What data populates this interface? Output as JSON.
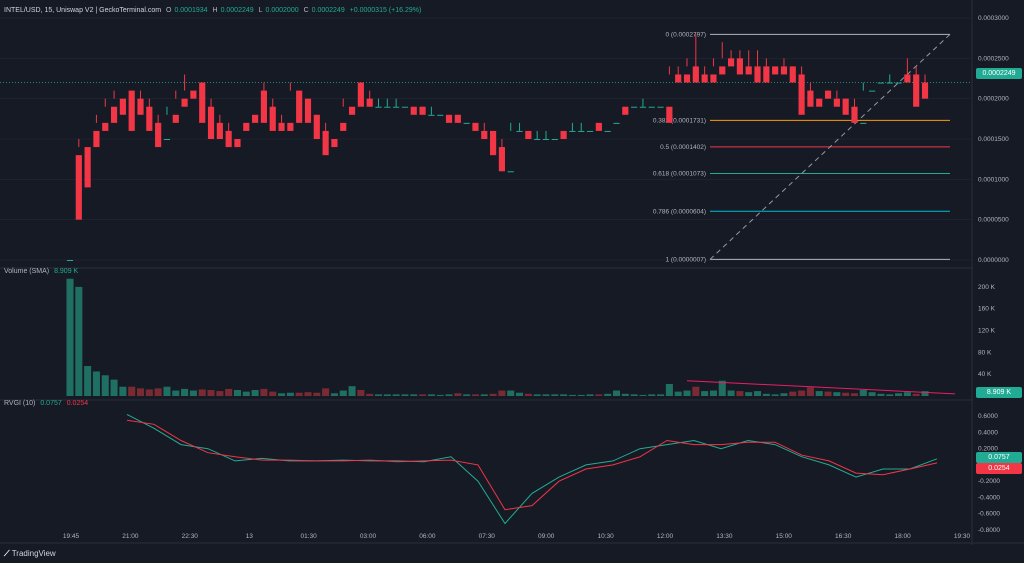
{
  "header": {
    "symbol": "INTEL/USD, 15, Uniswap V2 | GeckoTerminal.com",
    "open_label": "O",
    "open": "0.0001934",
    "high_label": "H",
    "high": "0.0002249",
    "low_label": "L",
    "low": "0.0002000",
    "close_label": "C",
    "close": "0.0002249",
    "change": "+0.0000315 (+16.29%)"
  },
  "volume_header": {
    "label": "Volume (SMA)",
    "value": "8.909 K"
  },
  "rvgi_header": {
    "label": "RVGI (10)",
    "value1": "0.0757",
    "value2": "0.0254"
  },
  "branding": {
    "logo": "TradingView",
    "logo_icon": "tradingview-logo-icon"
  },
  "price_tag": {
    "value": "0.0002249",
    "color": "#26a69a"
  },
  "volume_tag": {
    "value": "8.909 K"
  },
  "rvgi_tags": {
    "v1": "0.0757",
    "v2": "0.0254"
  },
  "colors": {
    "up": "#22ab94",
    "down": "#f23645",
    "bg": "#161a25"
  },
  "chart_data": [
    {
      "type": "candlestick",
      "x_ticks": [
        "19:45",
        "21:00",
        "22:30",
        "13",
        "01:30",
        "03:00",
        "06:00",
        "07:30",
        "09:00",
        "10:30",
        "12:00",
        "13:30",
        "15:00",
        "16:30",
        "18:00",
        "19:30"
      ],
      "y_ticks": [
        "0.0003000",
        "0.0002500",
        "0.0002000",
        "0.0001500",
        "0.0001000",
        "0.0000500",
        "0.0000000"
      ],
      "ylim": [
        0,
        0.0003
      ],
      "candles": [
        [
          0.0,
          0.00013,
          0.00013,
          0.0
        ],
        [
          0.00013,
          0.00015,
          0.00014,
          5e-05
        ],
        [
          0.00014,
          0.00016,
          0.00016,
          9e-05
        ],
        [
          0.00016,
          0.00018,
          0.00017,
          0.00014
        ],
        [
          0.00017,
          0.0002,
          0.00019,
          0.00016
        ],
        [
          0.00019,
          0.00021,
          0.0002,
          0.00017
        ],
        [
          0.0002,
          0.00021,
          0.00021,
          0.00018
        ],
        [
          0.00021,
          0.00021,
          0.0002,
          0.00016
        ],
        [
          0.0002,
          0.00021,
          0.00019,
          0.00018
        ],
        [
          0.00019,
          0.0002,
          0.00017,
          0.00016
        ],
        [
          0.00017,
          0.00018,
          0.00015,
          0.00014
        ],
        [
          0.00015,
          0.00019,
          0.00018,
          0.00015
        ],
        [
          0.00018,
          0.00021,
          0.0002,
          0.00017
        ],
        [
          0.0002,
          0.00023,
          0.00021,
          0.00019
        ],
        [
          0.00021,
          0.00022,
          0.00022,
          0.0002
        ],
        [
          0.00022,
          0.00022,
          0.00019,
          0.00017
        ],
        [
          0.00019,
          0.0002,
          0.00017,
          0.00015
        ],
        [
          0.00017,
          0.00018,
          0.00016,
          0.00015
        ],
        [
          0.00016,
          0.00017,
          0.00015,
          0.00014
        ],
        [
          0.00015,
          0.00017,
          0.00017,
          0.00014
        ],
        [
          0.00017,
          0.00018,
          0.00018,
          0.00016
        ],
        [
          0.00018,
          0.00021,
          0.00021,
          0.00017
        ],
        [
          0.00021,
          0.00022,
          0.00019,
          0.00017
        ],
        [
          0.00019,
          0.0002,
          0.00017,
          0.00016
        ],
        [
          0.00017,
          0.00018,
          0.00017,
          0.00016
        ],
        [
          0.00017,
          0.00022,
          0.00021,
          0.00016
        ],
        [
          0.00021,
          0.00021,
          0.0002,
          0.00017
        ],
        [
          0.0002,
          0.0002,
          0.00018,
          0.00017
        ],
        [
          0.00018,
          0.00018,
          0.00016,
          0.00015
        ],
        [
          0.00016,
          0.00017,
          0.00015,
          0.00013
        ],
        [
          0.00015,
          0.00017,
          0.00017,
          0.00014
        ],
        [
          0.00017,
          0.0002,
          0.00019,
          0.00016
        ],
        [
          0.00019,
          0.00022,
          0.00022,
          0.00018
        ],
        [
          0.00022,
          0.00022,
          0.0002,
          0.00019
        ],
        [
          0.0002,
          0.00021,
          0.00019,
          0.00019
        ],
        [
          0.00019,
          0.0002,
          0.00019,
          0.00019
        ],
        [
          0.00019,
          0.0002,
          0.00019,
          0.00019
        ],
        [
          0.00019,
          0.0002,
          0.00019,
          0.00019
        ],
        [
          0.00019,
          0.00019,
          0.00019,
          0.00019
        ],
        [
          0.00019,
          0.00019,
          0.00019,
          0.00018
        ],
        [
          0.00019,
          0.00019,
          0.00018,
          0.00018
        ],
        [
          0.00018,
          0.00019,
          0.00018,
          0.00018
        ],
        [
          0.00018,
          0.00018,
          0.00018,
          0.00018
        ],
        [
          0.00018,
          0.00018,
          0.00018,
          0.00017
        ],
        [
          0.00018,
          0.00018,
          0.00017,
          0.00017
        ],
        [
          0.00017,
          0.00017,
          0.00017,
          0.00017
        ],
        [
          0.00017,
          0.00017,
          0.00016,
          0.00016
        ],
        [
          0.00016,
          0.00017,
          0.00016,
          0.00015
        ],
        [
          0.00016,
          0.00016,
          0.00014,
          0.00013
        ],
        [
          0.00014,
          0.00015,
          0.00011,
          0.00011
        ],
        [
          0.00011,
          0.00017,
          0.00016,
          0.00011
        ],
        [
          0.00016,
          0.00017,
          0.00016,
          0.00016
        ],
        [
          0.00016,
          0.00016,
          0.00015,
          0.00015
        ],
        [
          0.00015,
          0.00016,
          0.00015,
          0.00015
        ],
        [
          0.00015,
          0.00016,
          0.00015,
          0.00015
        ],
        [
          0.00015,
          0.00016,
          0.00016,
          0.00015
        ],
        [
          0.00016,
          0.00016,
          0.00016,
          0.00015
        ],
        [
          0.00016,
          0.00017,
          0.00016,
          0.00016
        ],
        [
          0.00016,
          0.00017,
          0.00016,
          0.00016
        ],
        [
          0.00016,
          0.00017,
          0.00017,
          0.00016
        ],
        [
          0.00017,
          0.00017,
          0.00016,
          0.00016
        ],
        [
          0.00016,
          0.00017,
          0.00017,
          0.00016
        ],
        [
          0.00017,
          0.00019,
          0.00019,
          0.00017
        ],
        [
          0.00019,
          0.00019,
          0.00019,
          0.00018
        ],
        [
          0.00019,
          0.00019,
          0.00019,
          0.00019
        ],
        [
          0.00019,
          0.0002,
          0.00019,
          0.00019
        ],
        [
          0.00019,
          0.00019,
          0.00019,
          0.00019
        ],
        [
          0.00019,
          0.00019,
          0.00019,
          0.00019
        ],
        [
          0.00019,
          0.00024,
          0.00023,
          0.00017
        ],
        [
          0.00023,
          0.00024,
          0.00023,
          0.00022
        ],
        [
          0.00023,
          0.00025,
          0.00024,
          0.00022
        ],
        [
          0.00024,
          0.00028,
          0.00023,
          0.00022
        ],
        [
          0.00023,
          0.00024,
          0.00023,
          0.00022
        ],
        [
          0.00023,
          0.00025,
          0.00024,
          0.00022
        ],
        [
          0.00024,
          0.00027,
          0.00025,
          0.00023
        ],
        [
          0.00025,
          0.00026,
          0.00025,
          0.00024
        ],
        [
          0.00025,
          0.00026,
          0.00024,
          0.00023
        ],
        [
          0.00024,
          0.00026,
          0.00024,
          0.00023
        ],
        [
          0.00024,
          0.00026,
          0.00024,
          0.00022
        ],
        [
          0.00024,
          0.00025,
          0.00024,
          0.00022
        ],
        [
          0.00024,
          0.00024,
          0.00024,
          0.00023
        ],
        [
          0.00024,
          0.00025,
          0.00024,
          0.00023
        ],
        [
          0.00024,
          0.00024,
          0.00023,
          0.00022
        ],
        [
          0.00023,
          0.00024,
          0.00021,
          0.00018
        ],
        [
          0.00021,
          0.00022,
          0.0002,
          0.00019
        ],
        [
          0.0002,
          0.00021,
          0.00021,
          0.00019
        ],
        [
          0.00021,
          0.00021,
          0.0002,
          0.0002
        ],
        [
          0.0002,
          0.00021,
          0.0002,
          0.00019
        ],
        [
          0.0002,
          0.0002,
          0.00019,
          0.00018
        ],
        [
          0.00019,
          0.0002,
          0.00017,
          0.00017
        ],
        [
          0.00017,
          0.00022,
          0.00021,
          0.00017
        ],
        [
          0.00021,
          0.00022,
          0.00022,
          0.00021
        ],
        [
          0.00022,
          0.00022,
          0.00022,
          0.00022
        ],
        [
          0.00022,
          0.00023,
          0.00022,
          0.00022
        ],
        [
          0.00022,
          0.00023,
          0.00023,
          0.00022
        ],
        [
          0.00023,
          0.00025,
          0.00023,
          0.00022
        ],
        [
          0.00023,
          0.00024,
          0.00022,
          0.00019
        ],
        [
          0.00022,
          0.00023,
          0.00022,
          0.0002
        ]
      ],
      "fib_levels": [
        {
          "ratio": "0",
          "label": "0 (0.0002797)",
          "price": 0.0002797,
          "color": "#b2b5be"
        },
        {
          "ratio": "0.382",
          "label": "0.382 (0.0001731)",
          "price": 0.0001731,
          "color": "#ff9800"
        },
        {
          "ratio": "0.5",
          "label": "0.5 (0.0001402)",
          "price": 0.0001402,
          "color": "#f23645"
        },
        {
          "ratio": "0.618",
          "label": "0.618 (0.0001073)",
          "price": 0.0001073,
          "color": "#22ab94"
        },
        {
          "ratio": "0.786",
          "label": "0.786 (0.0000604)",
          "price": 6.04e-05,
          "color": "#00bcd4"
        },
        {
          "ratio": "1",
          "label": "1 (0.0000007)",
          "price": 7e-07,
          "color": "#b2b5be"
        }
      ]
    },
    {
      "type": "bar",
      "name": "Volume",
      "y_ticks": [
        "200 K",
        "160 K",
        "120 K",
        "80 K",
        "40 K"
      ],
      "ylim": [
        0,
        220000
      ],
      "values": [
        215000,
        200000,
        55000,
        45000,
        38000,
        30000,
        17000,
        17000,
        14000,
        12000,
        14000,
        17000,
        10000,
        13000,
        10000,
        12000,
        11000,
        9000,
        13000,
        11000,
        8000,
        11000,
        13000,
        8000,
        5000,
        6000,
        6000,
        7000,
        6000,
        14000,
        5000,
        10000,
        18000,
        11000,
        4000,
        3000,
        3000,
        3000,
        3000,
        3000,
        3000,
        3000,
        2000,
        3000,
        5000,
        3000,
        3000,
        3000,
        4000,
        10000,
        10000,
        6000,
        4000,
        3000,
        3000,
        3000,
        3000,
        2000,
        2000,
        3000,
        3000,
        4000,
        10000,
        4000,
        3000,
        2000,
        3000,
        3000,
        22000,
        8000,
        10000,
        17000,
        9000,
        10000,
        28000,
        10000,
        9000,
        7000,
        9000,
        4000,
        3000,
        5000,
        8000,
        10000,
        16000,
        9000,
        8000,
        7000,
        6000,
        5000,
        11000,
        7000,
        4000,
        3000,
        5000,
        7000,
        4000,
        8909
      ],
      "trendline": [
        [
          70,
          28000
        ],
        [
          97,
          4000
        ]
      ]
    },
    {
      "type": "line",
      "name": "RVGI (10)",
      "y_ticks": [
        "0.6000",
        "0.4000",
        "0.2000",
        "0.0000",
        "-0.2000",
        "-0.4000",
        "-0.6000",
        "-0.8000"
      ],
      "ylim": [
        -0.8,
        0.7
      ],
      "series": [
        {
          "name": "RVGI",
          "color": "#22ab94",
          "x": [
            0.03,
            0.06,
            0.09,
            0.12,
            0.15,
            0.18,
            0.21,
            0.24,
            0.27,
            0.3,
            0.33,
            0.36,
            0.39,
            0.42,
            0.45,
            0.48,
            0.51,
            0.54,
            0.57,
            0.6,
            0.63,
            0.66,
            0.69,
            0.72,
            0.75,
            0.78,
            0.81,
            0.84,
            0.87,
            0.9,
            0.93
          ],
          "values": [
            0.62,
            0.45,
            0.25,
            0.2,
            0.05,
            0.08,
            0.05,
            0.05,
            0.06,
            0.05,
            0.05,
            0.04,
            0.1,
            -0.2,
            -0.72,
            -0.35,
            -0.15,
            0.0,
            0.05,
            0.2,
            0.25,
            0.3,
            0.2,
            0.3,
            0.25,
            0.1,
            0.0,
            -0.15,
            -0.05,
            -0.05,
            0.0757
          ]
        },
        {
          "name": "Signal",
          "color": "#f23645",
          "x": [
            0.03,
            0.06,
            0.09,
            0.12,
            0.15,
            0.18,
            0.21,
            0.24,
            0.27,
            0.3,
            0.33,
            0.36,
            0.39,
            0.42,
            0.45,
            0.48,
            0.51,
            0.54,
            0.57,
            0.6,
            0.63,
            0.66,
            0.69,
            0.72,
            0.75,
            0.78,
            0.81,
            0.84,
            0.87,
            0.9,
            0.93
          ],
          "values": [
            0.55,
            0.5,
            0.3,
            0.15,
            0.1,
            0.06,
            0.06,
            0.05,
            0.05,
            0.06,
            0.04,
            0.05,
            0.06,
            0.0,
            -0.55,
            -0.5,
            -0.2,
            -0.05,
            0.0,
            0.1,
            0.3,
            0.25,
            0.25,
            0.28,
            0.28,
            0.12,
            0.05,
            -0.1,
            -0.12,
            -0.05,
            0.0254
          ]
        }
      ]
    }
  ]
}
